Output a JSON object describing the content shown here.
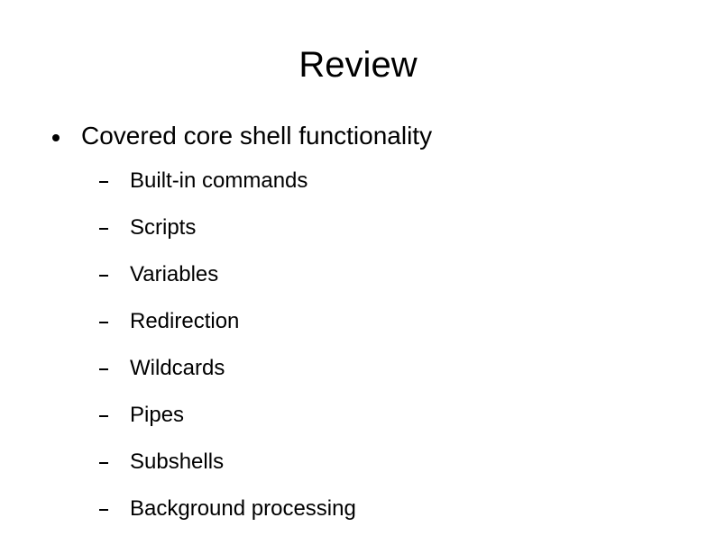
{
  "title": "Review",
  "main": {
    "text": "Covered core shell functionality",
    "subitems": [
      "Built-in commands",
      "Scripts",
      "Variables",
      "Redirection",
      "Wildcards",
      "Pipes",
      "Subshells",
      "Background processing"
    ]
  }
}
